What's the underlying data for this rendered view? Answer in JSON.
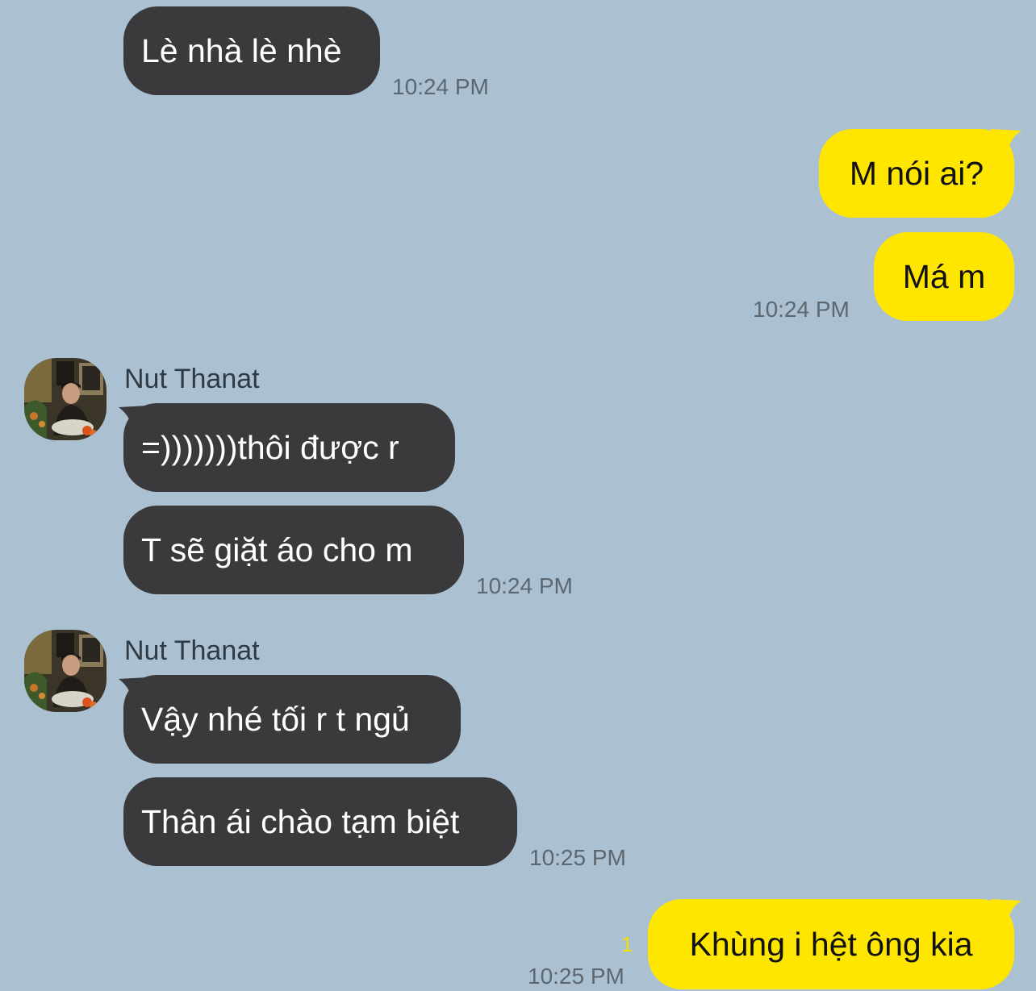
{
  "chat": {
    "messages": [
      {
        "direction": "in",
        "text": "Lè nhà lè nhè"
      },
      {
        "direction": "in",
        "time": "10:24 PM"
      },
      {
        "direction": "out",
        "text": "M nói ai?"
      },
      {
        "direction": "out",
        "text": "Má m"
      },
      {
        "direction": "out",
        "time": "10:24 PM"
      },
      {
        "direction": "in",
        "sender": "Nut Thanat",
        "text": "=)))))))thôi được r"
      },
      {
        "direction": "in",
        "text": "T sẽ giặt áo cho m"
      },
      {
        "direction": "in",
        "time": "10:24 PM"
      },
      {
        "direction": "in",
        "sender": "Nut Thanat",
        "text": "Vậy nhé tối r t ngủ"
      },
      {
        "direction": "in",
        "text": "Thân ái chào tạm biệt"
      },
      {
        "direction": "in",
        "time": "10:25 PM"
      },
      {
        "direction": "out",
        "unread": "1",
        "text": "Khùng i hệt ông kia"
      },
      {
        "direction": "out",
        "time": "10:25 PM"
      }
    ]
  },
  "colors": {
    "background": "#abc1d1",
    "incoming_bubble": "#3a3a3c",
    "outgoing_bubble": "#ffe600",
    "timestamp": "#5c6770",
    "unread_count": "#f2de00"
  },
  "icons": {
    "avatar": "profile-photo"
  }
}
